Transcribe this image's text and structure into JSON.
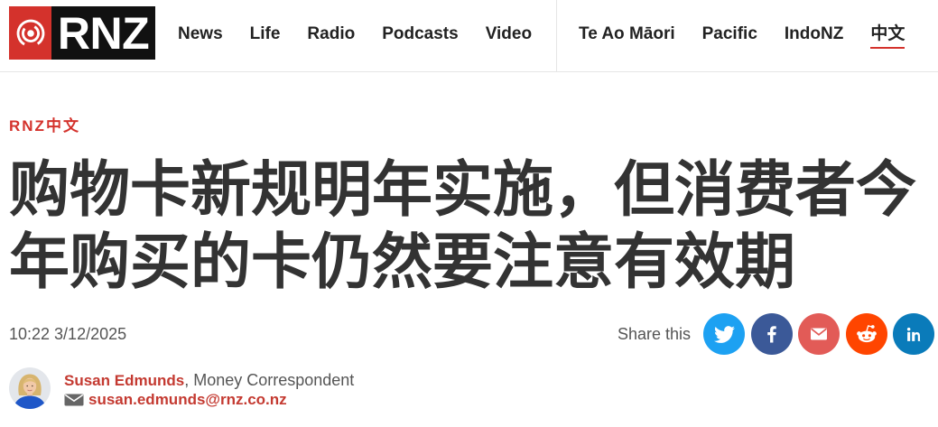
{
  "colors": {
    "brand_red": "#d4322c",
    "logo_black": "#111111",
    "text_dark": "#333333",
    "text_muted": "#555555",
    "link_red": "#c43a31",
    "divider": "#e6e6e6"
  },
  "header": {
    "logo": {
      "wordmark": "RNZ",
      "icon": "rnz-radio-waves-icon"
    },
    "nav_primary": [
      {
        "label": "News"
      },
      {
        "label": "Life"
      },
      {
        "label": "Radio"
      },
      {
        "label": "Podcasts"
      },
      {
        "label": "Video"
      }
    ],
    "nav_secondary": [
      {
        "label": "Te Ao Māori"
      },
      {
        "label": "Pacific"
      },
      {
        "label": "IndoNZ"
      },
      {
        "label": "中文",
        "active": true
      }
    ]
  },
  "article": {
    "section_label": "RNZ中文",
    "headline": "购物卡新规明年实施，但消费者今年购买的卡仍然要注意有效期",
    "timestamp": "10:22 3/12/2025",
    "share": {
      "label": "Share this",
      "buttons": [
        {
          "icon": "twitter-bird-icon",
          "color": "#1da1f2"
        },
        {
          "icon": "facebook-f-icon",
          "color": "#3b5998"
        },
        {
          "icon": "envelope-icon",
          "color": "#e25b57"
        },
        {
          "icon": "reddit-alien-icon",
          "color": "#ff4500"
        },
        {
          "icon": "linkedin-in-icon",
          "color": "#0a7bba"
        }
      ]
    },
    "author": {
      "avatar_icon": "author-photo",
      "name": "Susan Edmunds",
      "separator": ", ",
      "role": "Money Correspondent",
      "email_icon": "envelope-icon",
      "email": "susan.edmunds@rnz.co.nz"
    }
  }
}
